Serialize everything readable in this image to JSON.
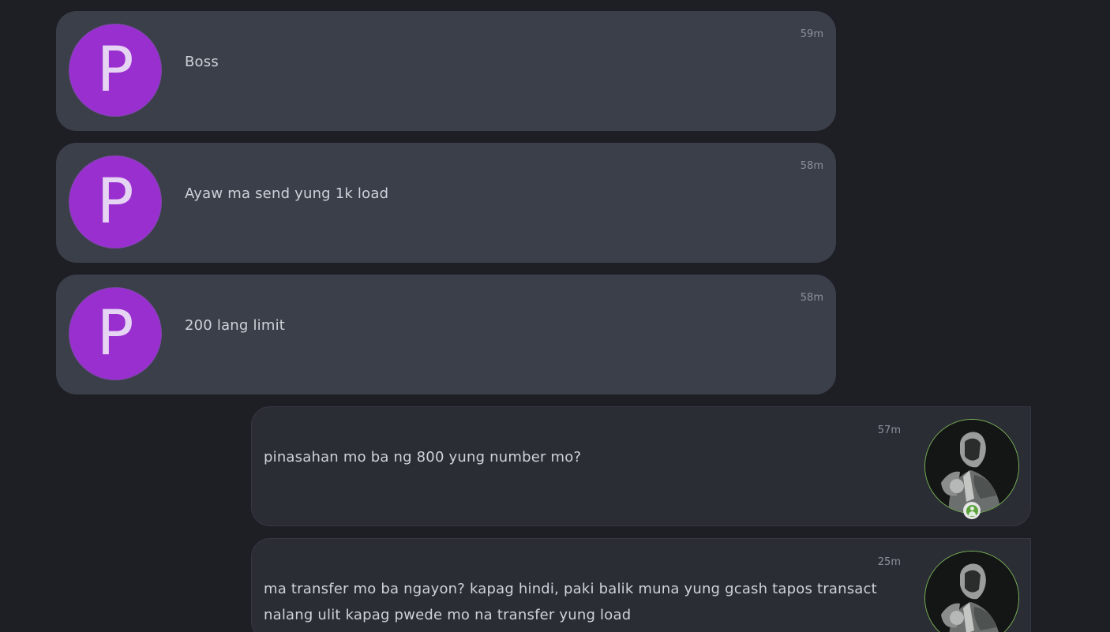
{
  "messages": [
    {
      "sender_initial": "P",
      "text": "Boss",
      "time": "59m",
      "direction": "incoming"
    },
    {
      "sender_initial": "P",
      "text": "Ayaw ma send yung 1k load",
      "time": "58m",
      "direction": "incoming"
    },
    {
      "sender_initial": "P",
      "text": "200 lang limit",
      "time": "58m",
      "direction": "incoming"
    },
    {
      "text": "pinasahan mo ba ng 800 yung number mo?",
      "time": "57m",
      "direction": "outgoing",
      "avatar_icon": "user-photo",
      "status_icon": "online-user-icon"
    },
    {
      "text": "ma transfer mo ba ngayon? kapag hindi, paki balik muna yung gcash tapos transact nalang ulit kapag pwede mo na transfer yung load",
      "time": "25m",
      "direction": "outgoing",
      "avatar_icon": "user-photo"
    }
  ],
  "colors": {
    "background": "#1e1f25",
    "incoming_bubble": "#3b3f4a",
    "outgoing_bubble": "#2b2d35",
    "letter_avatar": "#9a2fd0",
    "online_status": "#5ca33c"
  }
}
